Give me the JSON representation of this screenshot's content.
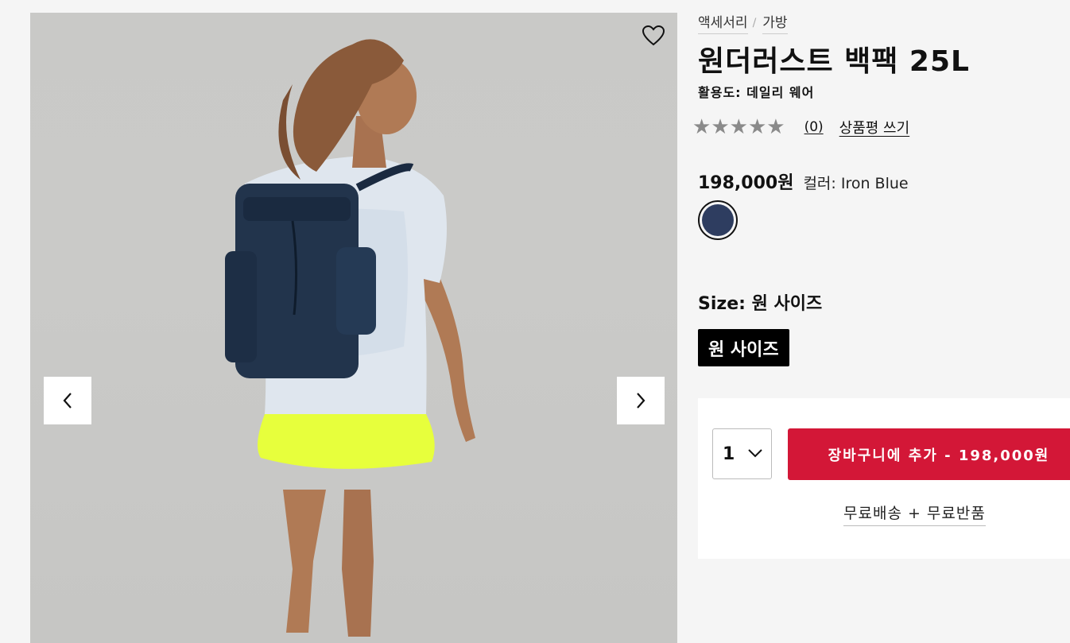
{
  "breadcrumb": {
    "items": [
      "액세서리",
      "가방"
    ],
    "separator": "/"
  },
  "product": {
    "title": "원더러스트 백팩 25L",
    "activity": "활용도: 데일리 웨어",
    "rating": {
      "stars": 0,
      "max": 5,
      "review_count": "(0)",
      "write_review": "상품평 쓰기"
    },
    "price": "198,000원",
    "color_label": "컬러: Iron Blue",
    "swatch_color": "#2e3d60",
    "size_label": "Size: 원 사이즈",
    "size_option": "원 사이즈"
  },
  "cart": {
    "quantity": "1",
    "add_to_cart": "장바구니에 추가 - 198,000원",
    "shipping_note": "무료배송 + 무료반품",
    "button_color": "#d31737"
  },
  "gallery": {
    "image_alt": "model wearing backpack",
    "wishlist_icon": "heart-outline-icon",
    "prev_icon": "chevron-left-icon",
    "next_icon": "chevron-right-icon"
  }
}
